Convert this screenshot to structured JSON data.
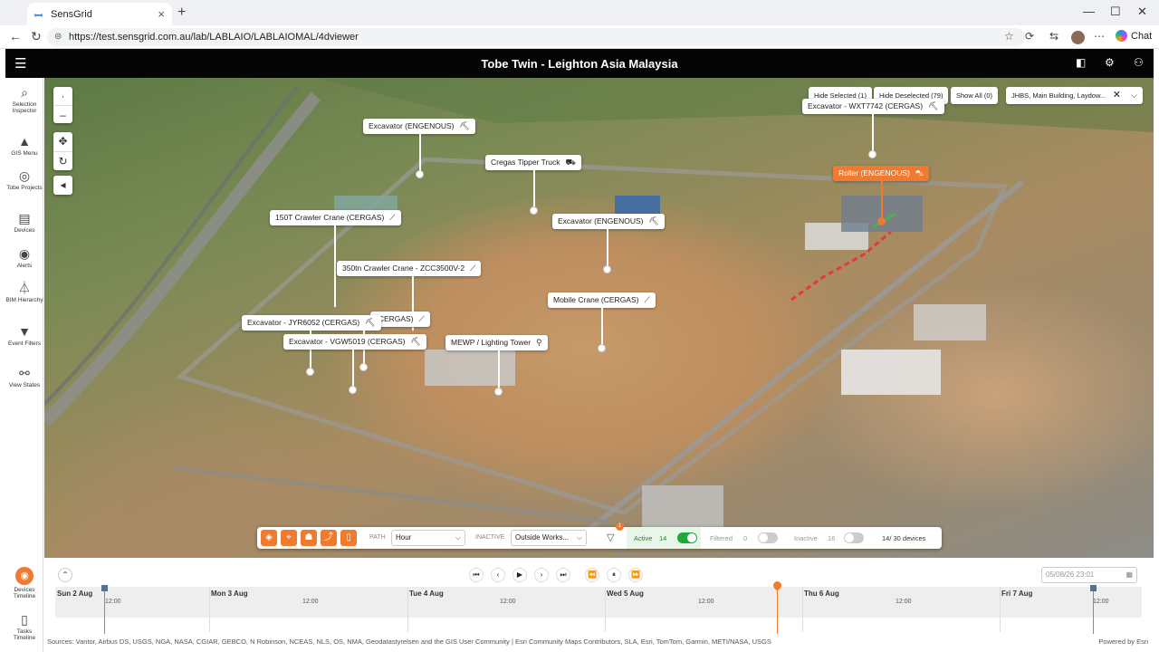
{
  "browser": {
    "tab_title": "SensGrid",
    "url": "https://test.sensgrid.com.au/lab/LABLAIO/LABLAIOMAL/4dviewer",
    "chat_label": "Chat"
  },
  "app": {
    "title": "Tobe Twin - Leighton Asia Malaysia",
    "sidebar": [
      {
        "label": "Selection Inspector",
        "icon": "search-icon"
      },
      {
        "label": "GIS Menu",
        "icon": "mountain-icon"
      },
      {
        "label": "Tobe Projects",
        "icon": "target-icon"
      },
      {
        "label": "Devices",
        "icon": "device-icon"
      },
      {
        "label": "Alerts",
        "icon": "alert-icon"
      },
      {
        "label": "BIM Hierarchy",
        "icon": "hierarchy-icon"
      },
      {
        "label": "Event Filters",
        "icon": "filter-icon"
      },
      {
        "label": "View States",
        "icon": "binoculars-icon"
      },
      {
        "label": "Devices Timeline",
        "icon": "signal-icon"
      },
      {
        "label": "Tasks Timeline",
        "icon": "document-icon"
      }
    ]
  },
  "map": {
    "hide_selected": "Hide Selected (1)",
    "hide_deselected": "Hide Deselected (79)",
    "show_all": "Show All (0)",
    "site_select": "JHBS, Main Building, Laydow...",
    "labels": [
      {
        "text": "Excavator (ENGENOUS)",
        "icon": "excavator-icon"
      },
      {
        "text": "Cregas Tipper Truck",
        "icon": "truck-icon"
      },
      {
        "text": "Excavator - WXT7742 (CERGAS)",
        "icon": "excavator-icon"
      },
      {
        "text": "Roller (ENGENOUS)",
        "icon": "roller-icon"
      },
      {
        "text": "150T Crawler Crane (CERGAS)",
        "icon": "crane-icon"
      },
      {
        "text": "Excavator (ENGENOUS)",
        "icon": "excavator-icon"
      },
      {
        "text": "350tn Crawler Crane - ZCC3500V-2",
        "icon": "crane-icon"
      },
      {
        "text": "Mobile Crane (CERGAS)",
        "icon": "crane-icon"
      },
      {
        "text": "(CERGAS)",
        "icon": "crane-icon"
      },
      {
        "text": "Excavator - JYR6052 (CERGAS)",
        "icon": "excavator-icon"
      },
      {
        "text": "Excavator - VGW5019 (CERGAS)",
        "icon": "excavator-icon"
      },
      {
        "text": "MEWP / Lighting Tower",
        "icon": "mewp-icon"
      }
    ],
    "attribution": "Sources: Vantor, Airbus DS, USGS, NGA, NASA, CGIAR, GEBCO, N Robinson, NCEAS, NLS, OS, NMA, Geodatastyrelsen and the GIS User Community | Esri Community Maps Contributors, SLA, Esri, TomTom, Garmin, METI/NASA, USGS",
    "powered_by": "Powered by Esri"
  },
  "filterbar": {
    "path_label": "PATH",
    "path_value": "Hour",
    "inactive_label": "INACTIVE",
    "inactive_value": "Outside Works...",
    "filter_badge": "1",
    "active_label": "Active",
    "active_count": "14",
    "filtered_label": "Filtered",
    "filtered_count": "0",
    "inactive2_label": "Inactive",
    "inactive2_count": "16",
    "devices_summary": "14/ 30 devices",
    "active_toggle_on": true,
    "filtered_toggle_on": false,
    "inactive_toggle_on": false
  },
  "timeline": {
    "date_value": "05/08/26 23:01",
    "days": [
      {
        "label": "Sun 2 Aug",
        "hour": "12:00"
      },
      {
        "label": "Mon 3 Aug",
        "hour": "12:00"
      },
      {
        "label": "Tue 4 Aug",
        "hour": "12:00"
      },
      {
        "label": "Wed 5 Aug",
        "hour": "12:00"
      },
      {
        "label": "Thu 6 Aug",
        "hour": "12:00"
      },
      {
        "label": "Fri 7 Aug",
        "hour": "12:00"
      }
    ]
  },
  "colors": {
    "accent": "#f07a2e",
    "topbar": "#050505",
    "toggle_on": "#22a83a"
  }
}
